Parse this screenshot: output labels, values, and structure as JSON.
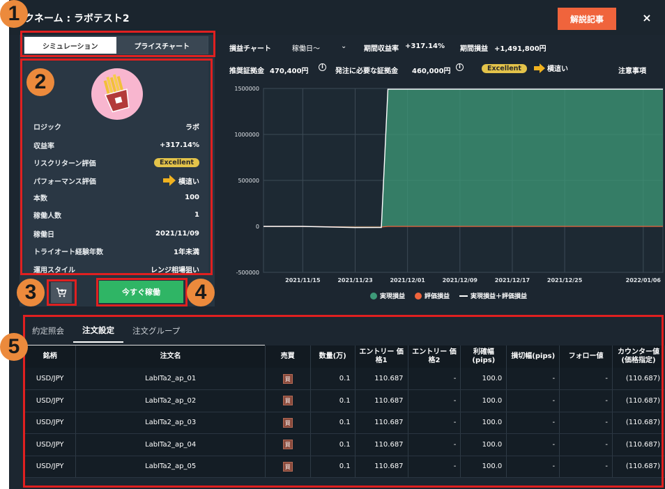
{
  "window": {
    "title": "ックネーム : ラボテスト2",
    "kaisetsu_label": "解説記事",
    "close_label": "×"
  },
  "toggle": {
    "simulation_label": "シミュレーション",
    "pricechart_label": "プライスチャート"
  },
  "strategy": {
    "avatar_icon": "french-fries-icon",
    "fields": [
      {
        "label": "ロジック",
        "value": "ラボ"
      },
      {
        "label": "収益率",
        "value": "+317.14%"
      },
      {
        "label": "リスクリターン評価",
        "value": "Excellent",
        "kind": "badge"
      },
      {
        "label": "パフォーマンス評価",
        "value": "横這い",
        "kind": "arrow"
      },
      {
        "label": "本数",
        "value": "100"
      },
      {
        "label": "稼働人数",
        "value": "1"
      },
      {
        "label": "稼働日",
        "value": "2021/11/09"
      },
      {
        "label": "トライオート経験年数",
        "value": "1年未満"
      },
      {
        "label": "運用スタイル",
        "value": "レンジ相場狙い"
      }
    ]
  },
  "actions": {
    "cart_icon": "cart-icon",
    "go_label": "今すぐ稼働"
  },
  "chart_header": {
    "title": "損益チャート",
    "period_select": "稼働日〜",
    "period_return_label": "期間収益率",
    "period_return_value": "+317.14%",
    "period_pl_label": "期間損益",
    "period_pl_value": "+1,491,800円",
    "recommended_margin_label": "推奨証拠金",
    "recommended_margin_value": "470,400円",
    "required_margin_label": "発注に必要な証拠金",
    "required_margin_value": "460,000円",
    "rating_badge": "Excellent",
    "trend_label": "横這い",
    "notes_link": "注意事項"
  },
  "chart_data": {
    "type": "area",
    "x": [
      "2021/11/09",
      "2021/11/15",
      "2021/11/23",
      "2021/11/27",
      "2021/11/28",
      "2021/12/01",
      "2021/12/09",
      "2021/12/17",
      "2021/12/25",
      "2022/01/06",
      "2022/01/09"
    ],
    "series": [
      {
        "name": "実現損益",
        "color": "#3d9a78",
        "values": [
          0,
          0,
          -5000,
          -5000,
          1491800,
          1491800,
          1491800,
          1491800,
          1491800,
          1491800,
          1491800
        ]
      },
      {
        "name": "評価損益",
        "color": "#f0643c",
        "values": [
          0,
          0,
          -8000,
          -7000,
          0,
          0,
          0,
          0,
          0,
          0,
          0
        ]
      },
      {
        "name": "実現損益＋評価損益",
        "color": "#ffffff",
        "values": [
          0,
          0,
          -13000,
          -12000,
          1491800,
          1491800,
          1491800,
          1491800,
          1491800,
          1491800,
          1491800
        ]
      }
    ],
    "xticks": [
      "2021/11/15",
      "2021/11/23",
      "2021/12/01",
      "2021/12/09",
      "2021/12/17",
      "2021/12/25",
      "2022/01/06"
    ],
    "yticks": [
      "1500000",
      "1000000",
      "500000",
      "0",
      "-500000"
    ],
    "ylim": [
      -500000,
      1500000
    ],
    "grid": true,
    "legend": "bottom"
  },
  "bottom_tabs": [
    {
      "label": "約定照会",
      "active": false
    },
    {
      "label": "注文設定",
      "active": true
    },
    {
      "label": "注文グループ",
      "active": false
    }
  ],
  "orders": {
    "columns": [
      "銘柄",
      "注文名",
      "売買",
      "数量(万)",
      "エントリー価格1",
      "エントリー価格2",
      "利確幅(pips)",
      "損切幅(pips)",
      "フォロー値",
      "カウンター値(価格指定)"
    ],
    "column_display": [
      "銘柄",
      "注文名",
      "売買",
      "数量(万)",
      "エントリー 価\n格1",
      "エントリー 価\n格2",
      "利確幅\n(pips)",
      "損切幅(pips)",
      "フォロー値",
      "カウンター値\n(価格指定)"
    ],
    "side_label": "買",
    "rows": [
      [
        "USD/JPY",
        "LabITa2_ap_01",
        "買",
        "0.1",
        "110.687",
        "-",
        "100.0",
        "-",
        "-",
        "(110.687)"
      ],
      [
        "USD/JPY",
        "LabITa2_ap_02",
        "買",
        "0.1",
        "110.687",
        "-",
        "100.0",
        "-",
        "-",
        "(110.687)"
      ],
      [
        "USD/JPY",
        "LabITa2_ap_03",
        "買",
        "0.1",
        "110.687",
        "-",
        "100.0",
        "-",
        "-",
        "(110.687)"
      ],
      [
        "USD/JPY",
        "LabITa2_ap_04",
        "買",
        "0.1",
        "110.687",
        "-",
        "100.0",
        "-",
        "-",
        "(110.687)"
      ],
      [
        "USD/JPY",
        "LabITa2_ap_05",
        "買",
        "0.1",
        "110.687",
        "-",
        "100.0",
        "-",
        "-",
        "(110.687)"
      ]
    ]
  },
  "annotations": [
    "1",
    "2",
    "3",
    "4",
    "5"
  ]
}
